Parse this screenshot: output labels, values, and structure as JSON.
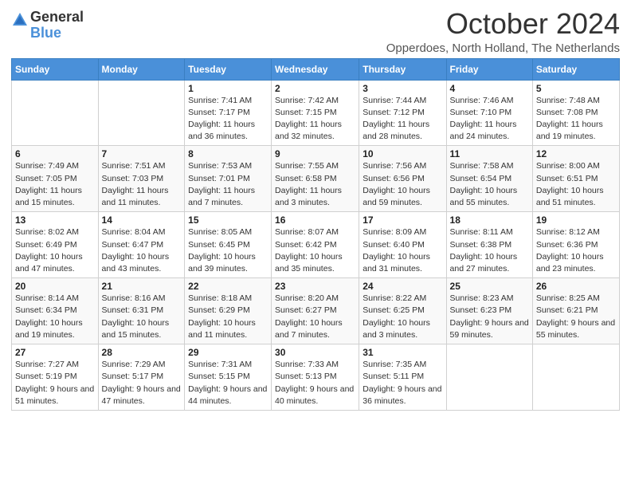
{
  "header": {
    "logo_general": "General",
    "logo_blue": "Blue",
    "month_title": "October 2024",
    "subtitle": "Opperdoes, North Holland, The Netherlands"
  },
  "weekdays": [
    "Sunday",
    "Monday",
    "Tuesday",
    "Wednesday",
    "Thursday",
    "Friday",
    "Saturday"
  ],
  "weeks": [
    [
      {
        "day": "",
        "content": ""
      },
      {
        "day": "",
        "content": ""
      },
      {
        "day": "1",
        "content": "Sunrise: 7:41 AM\nSunset: 7:17 PM\nDaylight: 11 hours and 36 minutes."
      },
      {
        "day": "2",
        "content": "Sunrise: 7:42 AM\nSunset: 7:15 PM\nDaylight: 11 hours and 32 minutes."
      },
      {
        "day": "3",
        "content": "Sunrise: 7:44 AM\nSunset: 7:12 PM\nDaylight: 11 hours and 28 minutes."
      },
      {
        "day": "4",
        "content": "Sunrise: 7:46 AM\nSunset: 7:10 PM\nDaylight: 11 hours and 24 minutes."
      },
      {
        "day": "5",
        "content": "Sunrise: 7:48 AM\nSunset: 7:08 PM\nDaylight: 11 hours and 19 minutes."
      }
    ],
    [
      {
        "day": "6",
        "content": "Sunrise: 7:49 AM\nSunset: 7:05 PM\nDaylight: 11 hours and 15 minutes."
      },
      {
        "day": "7",
        "content": "Sunrise: 7:51 AM\nSunset: 7:03 PM\nDaylight: 11 hours and 11 minutes."
      },
      {
        "day": "8",
        "content": "Sunrise: 7:53 AM\nSunset: 7:01 PM\nDaylight: 11 hours and 7 minutes."
      },
      {
        "day": "9",
        "content": "Sunrise: 7:55 AM\nSunset: 6:58 PM\nDaylight: 11 hours and 3 minutes."
      },
      {
        "day": "10",
        "content": "Sunrise: 7:56 AM\nSunset: 6:56 PM\nDaylight: 10 hours and 59 minutes."
      },
      {
        "day": "11",
        "content": "Sunrise: 7:58 AM\nSunset: 6:54 PM\nDaylight: 10 hours and 55 minutes."
      },
      {
        "day": "12",
        "content": "Sunrise: 8:00 AM\nSunset: 6:51 PM\nDaylight: 10 hours and 51 minutes."
      }
    ],
    [
      {
        "day": "13",
        "content": "Sunrise: 8:02 AM\nSunset: 6:49 PM\nDaylight: 10 hours and 47 minutes."
      },
      {
        "day": "14",
        "content": "Sunrise: 8:04 AM\nSunset: 6:47 PM\nDaylight: 10 hours and 43 minutes."
      },
      {
        "day": "15",
        "content": "Sunrise: 8:05 AM\nSunset: 6:45 PM\nDaylight: 10 hours and 39 minutes."
      },
      {
        "day": "16",
        "content": "Sunrise: 8:07 AM\nSunset: 6:42 PM\nDaylight: 10 hours and 35 minutes."
      },
      {
        "day": "17",
        "content": "Sunrise: 8:09 AM\nSunset: 6:40 PM\nDaylight: 10 hours and 31 minutes."
      },
      {
        "day": "18",
        "content": "Sunrise: 8:11 AM\nSunset: 6:38 PM\nDaylight: 10 hours and 27 minutes."
      },
      {
        "day": "19",
        "content": "Sunrise: 8:12 AM\nSunset: 6:36 PM\nDaylight: 10 hours and 23 minutes."
      }
    ],
    [
      {
        "day": "20",
        "content": "Sunrise: 8:14 AM\nSunset: 6:34 PM\nDaylight: 10 hours and 19 minutes."
      },
      {
        "day": "21",
        "content": "Sunrise: 8:16 AM\nSunset: 6:31 PM\nDaylight: 10 hours and 15 minutes."
      },
      {
        "day": "22",
        "content": "Sunrise: 8:18 AM\nSunset: 6:29 PM\nDaylight: 10 hours and 11 minutes."
      },
      {
        "day": "23",
        "content": "Sunrise: 8:20 AM\nSunset: 6:27 PM\nDaylight: 10 hours and 7 minutes."
      },
      {
        "day": "24",
        "content": "Sunrise: 8:22 AM\nSunset: 6:25 PM\nDaylight: 10 hours and 3 minutes."
      },
      {
        "day": "25",
        "content": "Sunrise: 8:23 AM\nSunset: 6:23 PM\nDaylight: 9 hours and 59 minutes."
      },
      {
        "day": "26",
        "content": "Sunrise: 8:25 AM\nSunset: 6:21 PM\nDaylight: 9 hours and 55 minutes."
      }
    ],
    [
      {
        "day": "27",
        "content": "Sunrise: 7:27 AM\nSunset: 5:19 PM\nDaylight: 9 hours and 51 minutes."
      },
      {
        "day": "28",
        "content": "Sunrise: 7:29 AM\nSunset: 5:17 PM\nDaylight: 9 hours and 47 minutes."
      },
      {
        "day": "29",
        "content": "Sunrise: 7:31 AM\nSunset: 5:15 PM\nDaylight: 9 hours and 44 minutes."
      },
      {
        "day": "30",
        "content": "Sunrise: 7:33 AM\nSunset: 5:13 PM\nDaylight: 9 hours and 40 minutes."
      },
      {
        "day": "31",
        "content": "Sunrise: 7:35 AM\nSunset: 5:11 PM\nDaylight: 9 hours and 36 minutes."
      },
      {
        "day": "",
        "content": ""
      },
      {
        "day": "",
        "content": ""
      }
    ]
  ]
}
